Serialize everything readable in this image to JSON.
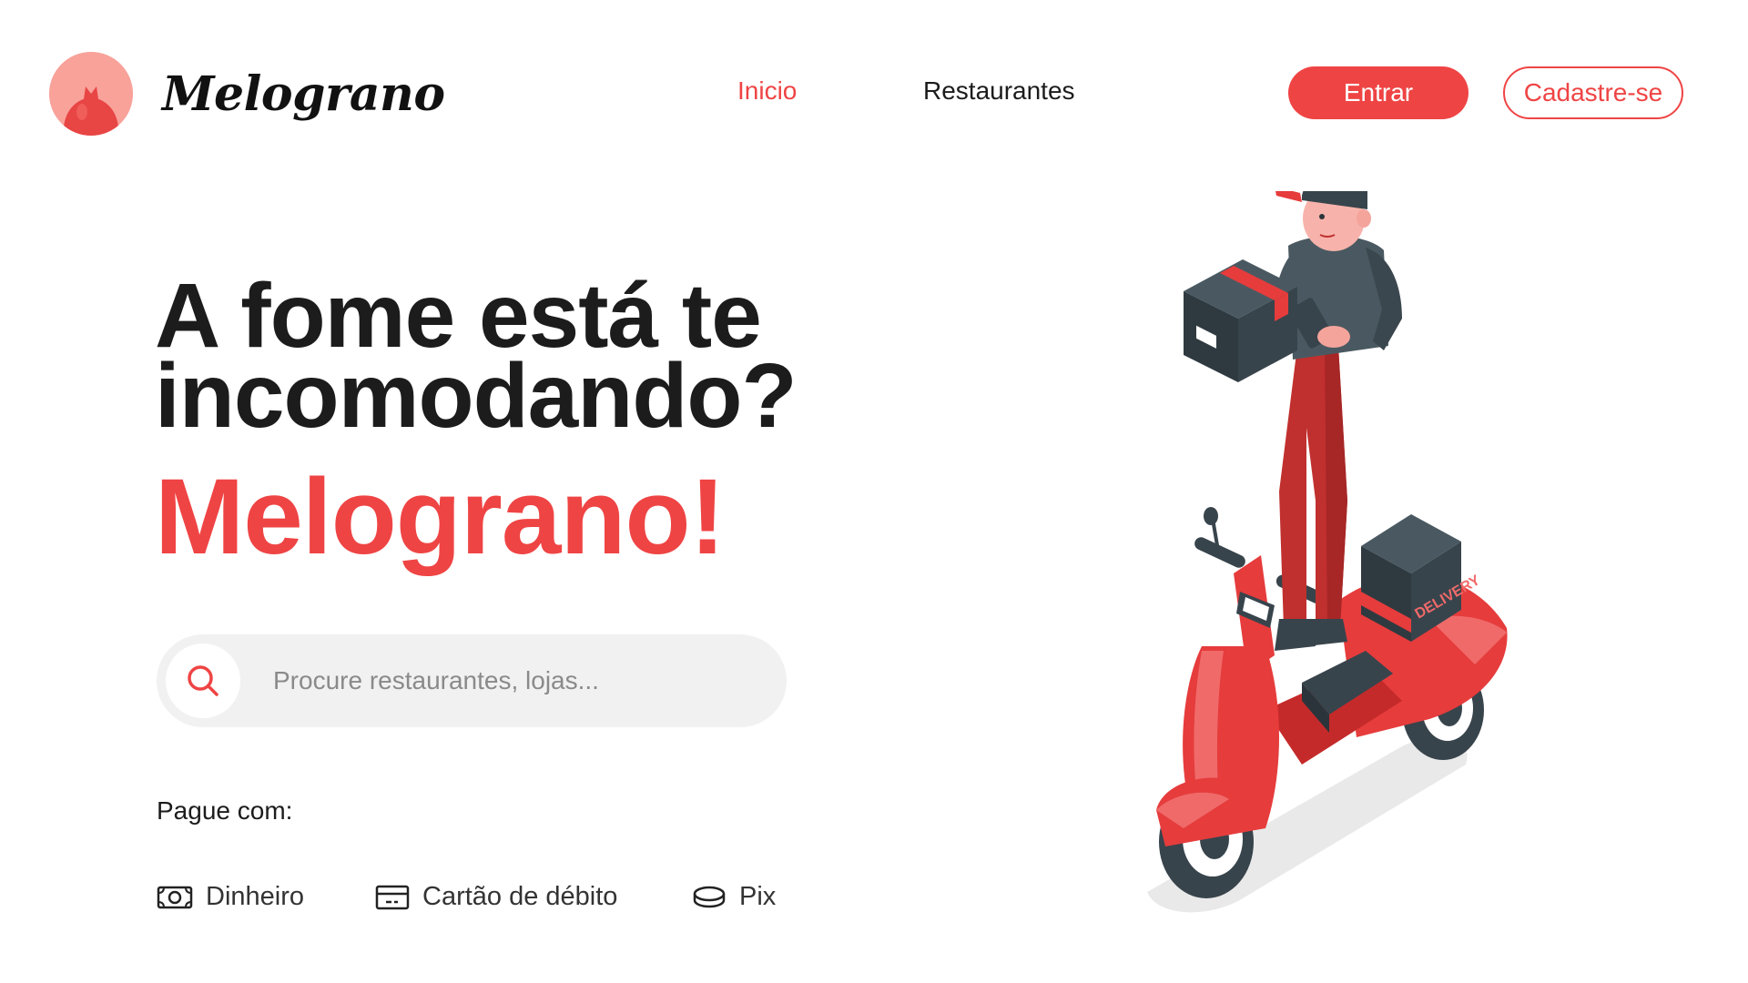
{
  "brand": {
    "name": "Melograno",
    "logo_icon": "pomegranate-icon",
    "accent_color": "#ef4444",
    "logo_bg_color": "#f8a29a"
  },
  "nav": {
    "items": [
      {
        "label": "Inicio",
        "active": true
      },
      {
        "label": "Restaurantes",
        "active": false
      }
    ]
  },
  "auth": {
    "login_label": "Entrar",
    "signup_label": "Cadastre-se"
  },
  "hero": {
    "headline_line1": "A fome está te",
    "headline_line2": "incomodando?",
    "brand_line": "Melograno!"
  },
  "search": {
    "placeholder": "Procure restaurantes, lojas...",
    "value": "",
    "icon": "search-icon"
  },
  "payment": {
    "title": "Pague com:",
    "methods": [
      {
        "label": "Dinheiro",
        "icon": "cash-icon"
      },
      {
        "label": "Cartão de débito",
        "icon": "card-icon"
      },
      {
        "label": "Pix",
        "icon": "coin-icon"
      }
    ]
  },
  "illustration": {
    "box_label": "DELIVERY",
    "subject": "delivery-person-scooter"
  }
}
